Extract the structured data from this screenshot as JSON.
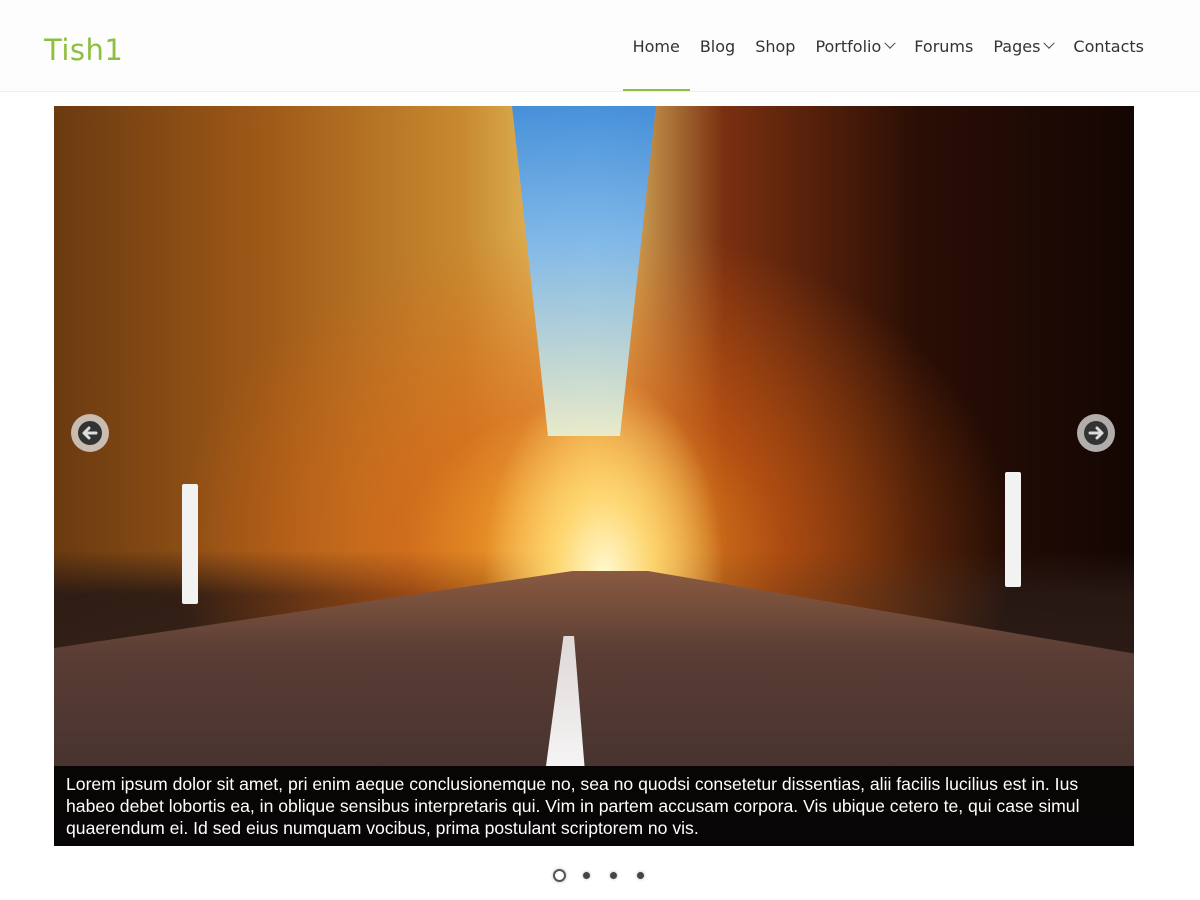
{
  "site": {
    "logo": "Tish1",
    "accent_color": "#8fbf3f"
  },
  "nav": {
    "items": [
      {
        "label": "Home",
        "active": true,
        "dropdown": false
      },
      {
        "label": "Blog",
        "active": false,
        "dropdown": false
      },
      {
        "label": "Shop",
        "active": false,
        "dropdown": false
      },
      {
        "label": "Portfolio",
        "active": false,
        "dropdown": true
      },
      {
        "label": "Forums",
        "active": false,
        "dropdown": false
      },
      {
        "label": "Pages",
        "active": false,
        "dropdown": true
      },
      {
        "label": "Contacts",
        "active": false,
        "dropdown": false
      }
    ]
  },
  "slider": {
    "caption": "Lorem ipsum dolor sit amet, pri enim aeque conclusionemque no, sea no quodsi consetetur dissentias, alii facilis lucilius est in. Ius habeo debet lobortis ea, in oblique sensibus interpretaris qui. Vim in partem accusam corpora. Vis ubique cetero te, qui case simul quaerendum ei. Id sed eius numquam vocibus, prima postulant scriptorem no vis.",
    "prev_icon": "arrow-left-icon",
    "next_icon": "arrow-right-icon",
    "slide_count": 4,
    "active_slide": 1
  }
}
